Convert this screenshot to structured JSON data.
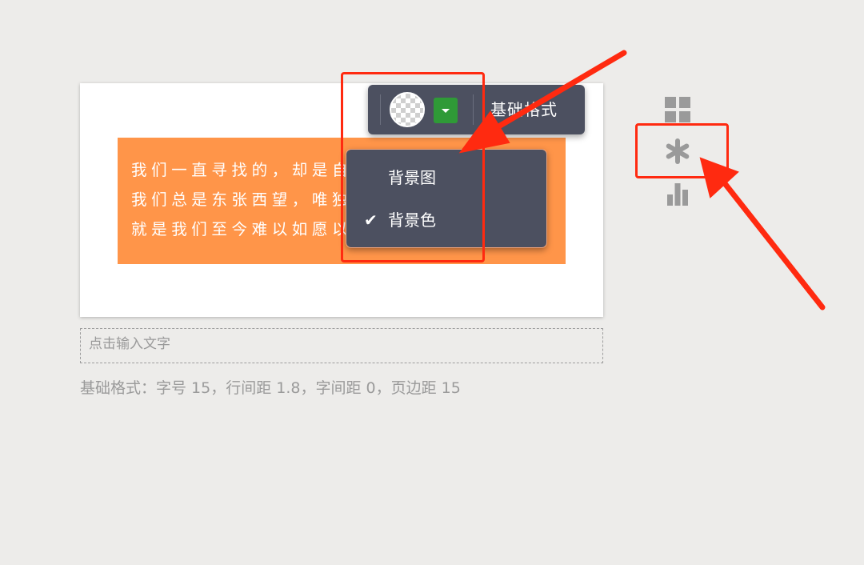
{
  "canvas": {
    "paragraph": "我们一直寻找的，却是自己原本早已拥有的；我们总是东张西望，唯独漏了自己想要的，这就是我们至今难以如愿以偿的原因。"
  },
  "toolbar": {
    "background_swatch": "transparent-swatch",
    "basic_format_label": "基础格式"
  },
  "background_menu": {
    "items": [
      {
        "label": "背景图",
        "checked": false
      },
      {
        "label": "背景色",
        "checked": true
      }
    ],
    "check_glyph": "✔"
  },
  "text_input": {
    "placeholder": "点击输入文字"
  },
  "format_info": {
    "text": "基础格式：字号 15，行间距 1.8，字间距 0，页边距 15"
  },
  "side_panel": {
    "icons": [
      "grid-icon",
      "asterisk-icon",
      "bar-chart-icon"
    ]
  },
  "colors": {
    "page_bg": "#edecea",
    "block_bg": "#ff9549",
    "toolbar_bg": "#4c5060",
    "dropdown_green": "#2f9a37",
    "annotation_red": "#ff2a10",
    "icon_gray": "#9a9a9a"
  }
}
